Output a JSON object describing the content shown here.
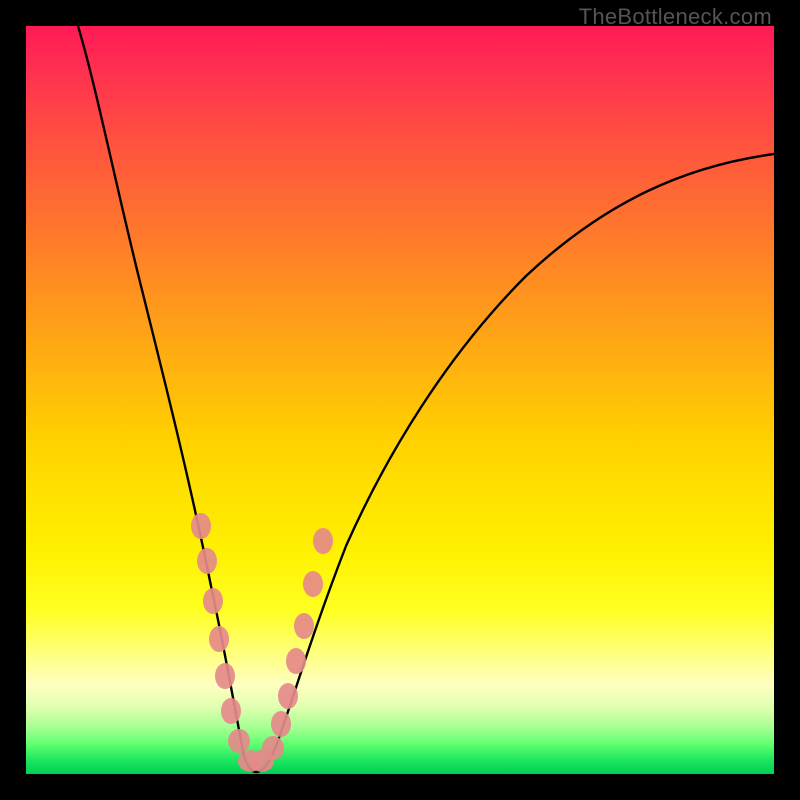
{
  "watermark": "TheBottleneck.com",
  "chart_data": {
    "type": "line",
    "title": "",
    "xlabel": "",
    "ylabel": "",
    "xlim": [
      0,
      100
    ],
    "ylim": [
      0,
      100
    ],
    "description": "V-shaped bottleneck curve over rainbow heatmap gradient (red=high bottleneck, green=low bottleneck). Trough around x≈29 at y≈0; left arm steep to top-left edge; right arm shallower rising toward upper-right.",
    "series": [
      {
        "name": "curve-left",
        "x": [
          7,
          10,
          14,
          18,
          22,
          25,
          27,
          29
        ],
        "values": [
          100,
          88,
          72,
          54,
          34,
          15,
          5,
          0
        ]
      },
      {
        "name": "curve-right",
        "x": [
          29,
          32,
          35,
          40,
          48,
          58,
          70,
          85,
          100
        ],
        "values": [
          0,
          4,
          12,
          25,
          42,
          57,
          68,
          76,
          82
        ]
      }
    ],
    "markers": {
      "name": "dot-cluster",
      "color": "#e58a8a",
      "points": [
        {
          "x": 22.5,
          "y": 34
        },
        {
          "x": 23.5,
          "y": 29
        },
        {
          "x": 24.3,
          "y": 23
        },
        {
          "x": 25.0,
          "y": 18
        },
        {
          "x": 25.8,
          "y": 13
        },
        {
          "x": 26.6,
          "y": 8
        },
        {
          "x": 27.8,
          "y": 4
        },
        {
          "x": 29.0,
          "y": 1.5
        },
        {
          "x": 30.0,
          "y": 1.5
        },
        {
          "x": 31.2,
          "y": 3
        },
        {
          "x": 32.2,
          "y": 6
        },
        {
          "x": 33.2,
          "y": 10
        },
        {
          "x": 34.2,
          "y": 15
        },
        {
          "x": 35.2,
          "y": 20
        },
        {
          "x": 36.4,
          "y": 26
        },
        {
          "x": 37.8,
          "y": 32
        }
      ]
    },
    "gradient_stops": [
      {
        "pos": 0,
        "color": "#ff1a55"
      },
      {
        "pos": 50,
        "color": "#ffd000"
      },
      {
        "pos": 80,
        "color": "#ffff60"
      },
      {
        "pos": 100,
        "color": "#00d050"
      }
    ]
  }
}
